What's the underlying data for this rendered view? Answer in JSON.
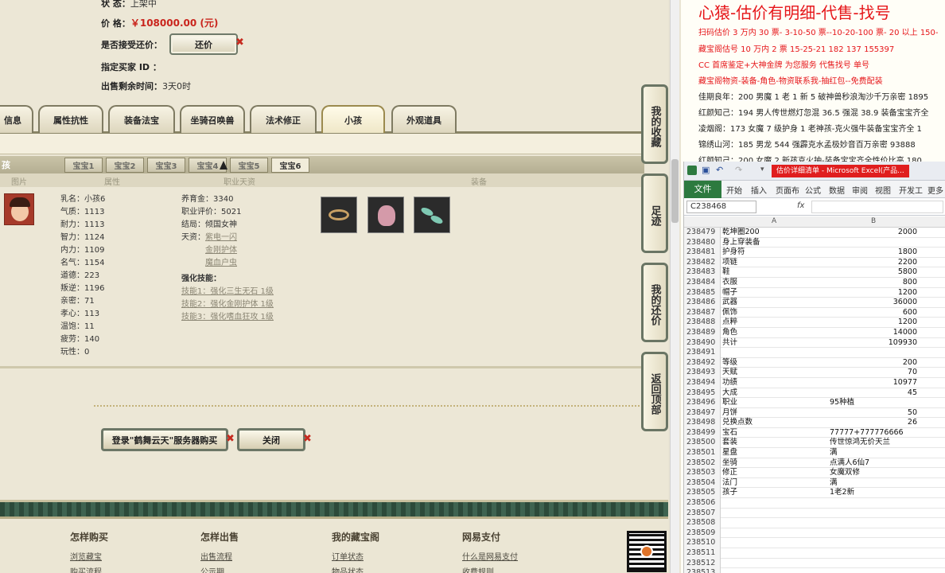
{
  "listing": {
    "status_label": "状        态：",
    "status_value": "上架中",
    "price_label": "价        格：",
    "price_value": "￥108000.00 (元)",
    "accept_label": "是否接受还价：",
    "counter_btn": "还价",
    "buyer_label": "指定买家 ID ：",
    "remaining_label": "出售剩余时间：",
    "remaining_value": "3天0时"
  },
  "tabs": [
    "信息",
    "属性抗性",
    "装备法宝",
    "坐骑召唤兽",
    "法术修正",
    "小孩",
    "外观道具"
  ],
  "child_panel": {
    "title": "孩",
    "subtabs": [
      "宝宝1",
      "宝宝2",
      "宝宝3",
      "宝宝4",
      "宝宝5",
      "宝宝6"
    ],
    "columns": [
      "图片",
      "属性",
      "职业天资",
      "装备"
    ],
    "attrs": [
      "乳名：小孩6",
      "气质：1113",
      "耐力：1113",
      "智力：1124",
      "内力：1109",
      "名气：1154",
      "道德：223",
      "叛逆：1196",
      "亲密：71",
      "孝心：113",
      "温饱：11",
      "疲劳：140",
      "玩性：0"
    ],
    "career": [
      "养育金：3340",
      "职业评价：5021",
      "结局：倾国女神"
    ],
    "talent_label": "天资：",
    "talents": [
      "紫电一闪",
      "金刚护体",
      "魔血户虫"
    ],
    "skill_label": "强化技能：",
    "skills": [
      "技能1：强化三生无石 1级",
      "技能2：强化金刚护体 1级",
      "技能3：强化嗜血狂攻 1级"
    ]
  },
  "actions": {
    "login_buy": "登录\"鹤舞云天\"服务器购买",
    "close": "关闭"
  },
  "sidebar": [
    "我的收藏",
    "足迹",
    "我的还价",
    "返回顶部"
  ],
  "footer": {
    "cols": [
      {
        "head": "怎样购买",
        "links": [
          "浏览藏宝",
          "购买流程"
        ]
      },
      {
        "head": "怎样出售",
        "links": [
          "出售流程",
          "公示期"
        ]
      },
      {
        "head": "我的藏宝阁",
        "links": [
          "订单状态",
          "物品状态"
        ]
      },
      {
        "head": "网易支付",
        "links": [
          "什么是网易支付",
          "收费规则"
        ]
      }
    ]
  },
  "overlay": {
    "title": "心猿-估价有明细-代售-找号",
    "lines": [
      "扫码估价 3 万内 30 票- 3-10-50 票--10-20-100 票- 20 以上 150-",
      "藏宝阁估号 10 万内 2 票  15-25-21 182  137 155397",
      "CC 首席鉴定+大神金牌  为您服务 代售找号 单号",
      "藏宝阁物资-装备-角色-物资联系我-抽红包--免费配装",
      "佳期良年：200 男魔 1 老 1 新 5 破神兽秒浪淘沙千万亲密 1895",
      "红颜知己：194 男人传世燃灯忽混 36.5 强混 38.9 装备宝宝齐全",
      "凌烟阁：173 女魔 7 级护身 1 老神孩-克火强牛装备宝宝齐全 1",
      "锦绣山河：185 男龙 544 强霹克水孟极妙音百万亲密 93888",
      "红颜知己：200 女魔 2 新孩克火抽-装备宝宝齐全性价比高 180"
    ]
  },
  "excel": {
    "window_title": "估价详细清单 - Microsoft Excel(产品...",
    "file_tab": "文件",
    "ribbon": [
      "开始",
      "插入",
      "页面布",
      "公式",
      "数据",
      "审阅",
      "视图",
      "开发工",
      "更多"
    ],
    "name_box": "C238468",
    "fx": "fx",
    "col_a": "A",
    "col_b": "B",
    "rows": [
      [
        "238479",
        "乾坤圈200",
        "2000"
      ],
      [
        "238480",
        "身上穿装备",
        ""
      ],
      [
        "238481",
        "护身符",
        "1800"
      ],
      [
        "238482",
        "项链",
        "2200"
      ],
      [
        "238483",
        "鞋",
        "5800"
      ],
      [
        "238484",
        "衣服",
        "800"
      ],
      [
        "238485",
        "帽子",
        "1200"
      ],
      [
        "238486",
        "武器",
        "36000"
      ],
      [
        "238487",
        "佩饰",
        "600"
      ],
      [
        "238488",
        "点粹",
        "1200"
      ],
      [
        "238489",
        "角色",
        "14000"
      ],
      [
        "238490",
        "共计",
        "109930"
      ],
      [
        "238491",
        "",
        ""
      ],
      [
        "238492",
        "等级",
        "200"
      ],
      [
        "238493",
        "天赋",
        "70"
      ],
      [
        "238494",
        "功绩",
        "10977"
      ],
      [
        "238495",
        "大成",
        "45"
      ],
      [
        "238496",
        "职业",
        "95种植"
      ],
      [
        "238497",
        "月饼",
        "50"
      ],
      [
        "238498",
        "兑换点数",
        "26"
      ],
      [
        "238499",
        "宝石",
        "77777+777776666"
      ],
      [
        "238500",
        "套装",
        "传世惊鸿无价天兰"
      ],
      [
        "238501",
        "星盘",
        "满"
      ],
      [
        "238502",
        "坐骑",
        "点满人6仙7"
      ],
      [
        "238503",
        "修正",
        "女魔双修"
      ],
      [
        "238504",
        "法门",
        "满"
      ],
      [
        "238505",
        "孩子",
        "1老2新"
      ],
      [
        "238506",
        "",
        ""
      ],
      [
        "238507",
        "",
        ""
      ],
      [
        "238508",
        "",
        ""
      ],
      [
        "238509",
        "",
        ""
      ],
      [
        "238510",
        "",
        ""
      ],
      [
        "238511",
        "",
        ""
      ],
      [
        "238512",
        "",
        ""
      ],
      [
        "238513",
        "",
        ""
      ]
    ]
  }
}
